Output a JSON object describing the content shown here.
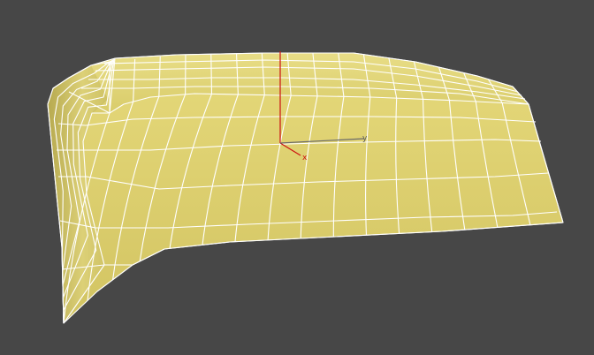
{
  "viewport": {
    "background_color": "#474747",
    "object": {
      "type": "surface-patch",
      "fill_color": "#DDD06C",
      "wire_color": "#FFFFFF"
    },
    "gizmo": {
      "x_label": "x",
      "y_label": "y",
      "x_axis_color": "#CC1111",
      "y_axis_color": "#6A6A6A",
      "z_axis_color": "#CC1111"
    }
  }
}
